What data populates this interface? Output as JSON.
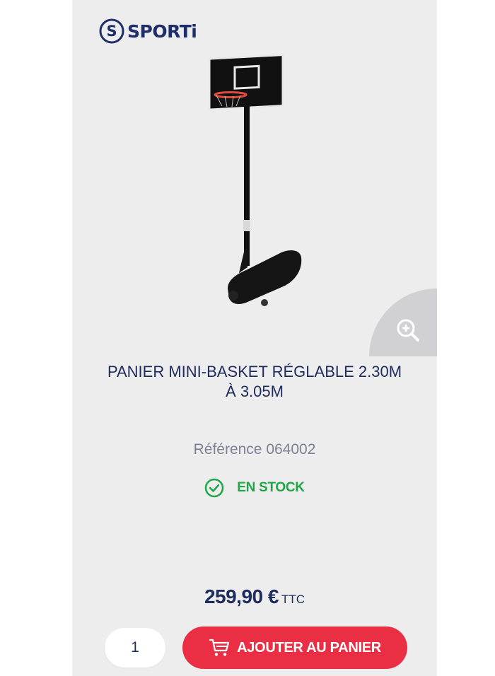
{
  "brand": {
    "logo_letter": "S",
    "name": "SPORTi",
    "color": "#1d2e6a"
  },
  "product": {
    "title_line1": "PANIER MINI-BASKET RÉGLABLE 2.30M",
    "title_line2": "À 3.05M",
    "reference": "Référence 064002",
    "stock_status": "EN STOCK",
    "price": "259,90 €",
    "price_suffix": "TTC"
  },
  "cart": {
    "quantity": "1",
    "add_button_label": "AJOUTER AU PANIER",
    "button_color": "#ea2f45"
  },
  "icons": {
    "zoom": "zoom-in-icon",
    "stock": "check-circle-icon",
    "cart": "shopping-cart-icon"
  },
  "colors": {
    "stock_green": "#1ea646",
    "text_navy": "#1f2c5e",
    "card_background": "#ededee"
  }
}
